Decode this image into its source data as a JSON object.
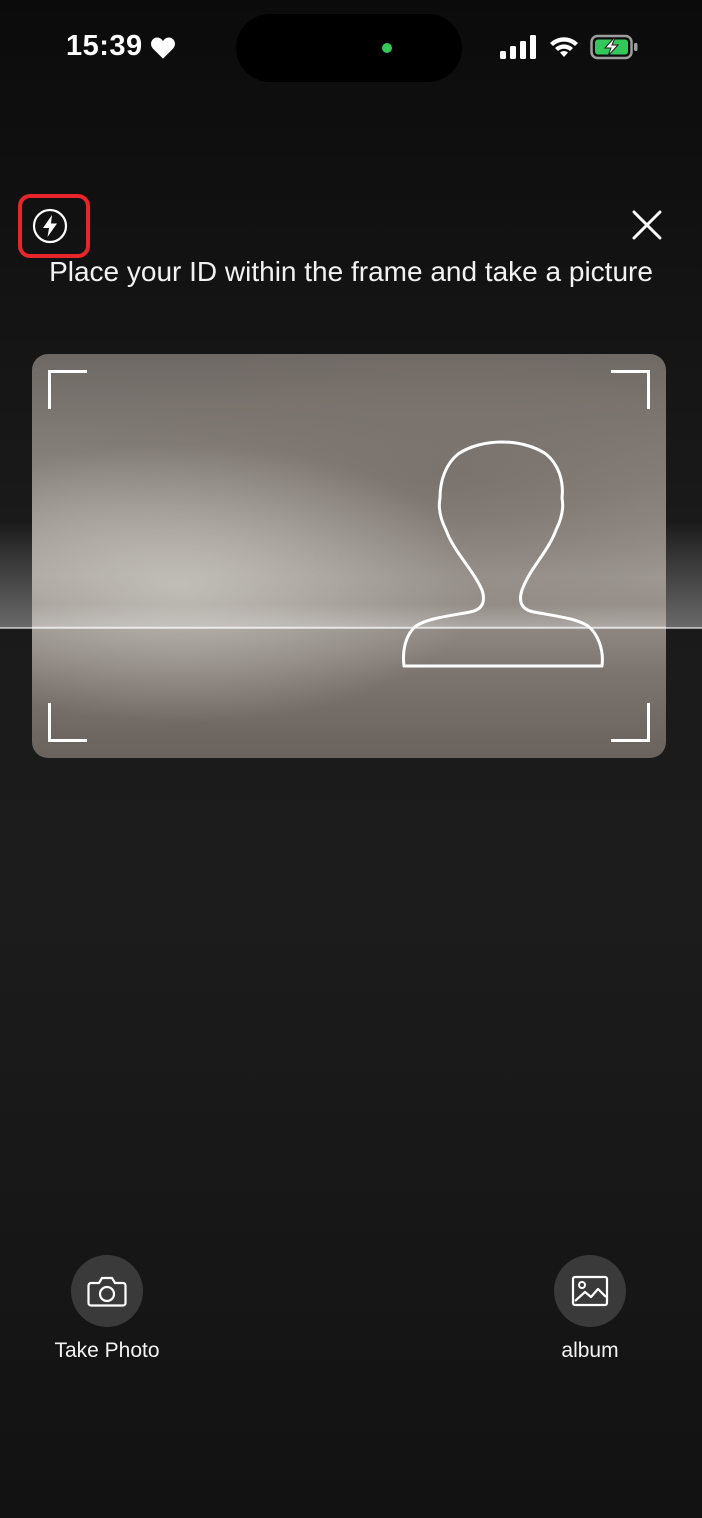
{
  "status_bar": {
    "time": "15:39",
    "icons": [
      "heart-icon",
      "cellular-signal-icon",
      "wifi-icon",
      "battery-charging-icon"
    ],
    "camera_indicator_color": "#34c759"
  },
  "toolbar": {
    "flash_icon": "flash-icon",
    "close_icon": "close-icon",
    "highlight_color": "#e8252a"
  },
  "instruction": "Place your ID within the frame and take a picture",
  "frame": {
    "placeholder_icon": "person-silhouette-icon"
  },
  "actions": {
    "take_photo_label": "Take Photo",
    "take_photo_icon": "camera-icon",
    "album_label": "album",
    "album_icon": "image-icon"
  }
}
